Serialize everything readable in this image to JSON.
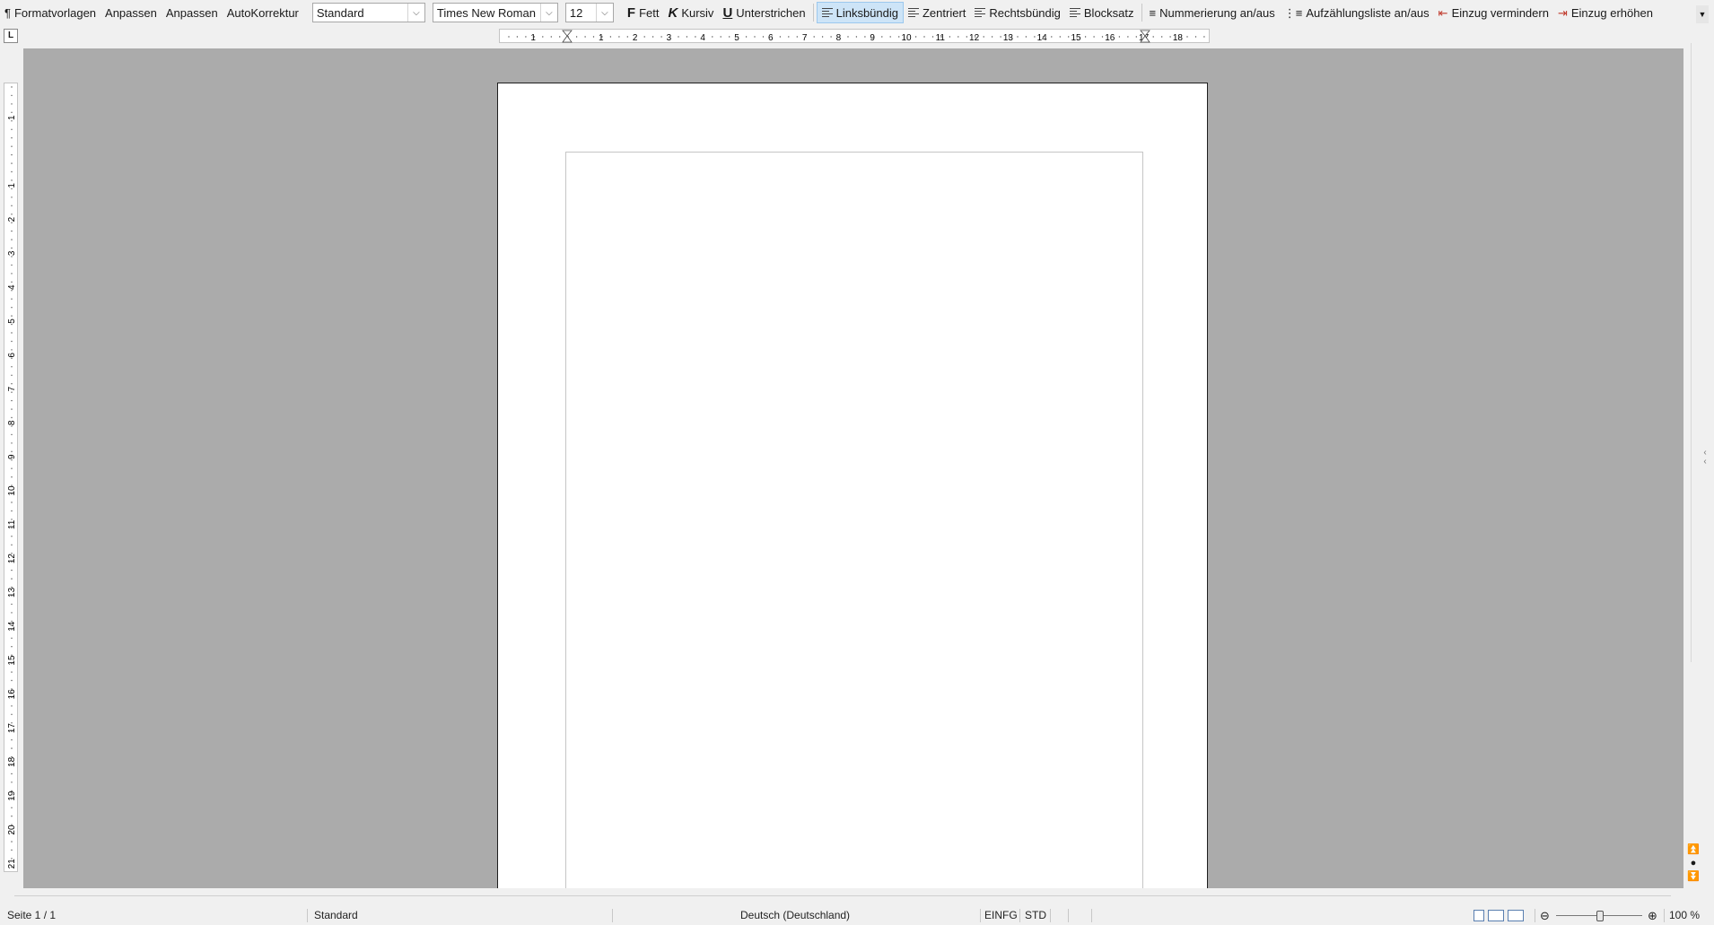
{
  "toolbar": {
    "format_templates": "Formatvorlagen",
    "customize1": "Anpassen",
    "customize2": "Anpassen",
    "autocorrect": "AutoKorrektur",
    "para_style": "Standard",
    "font_name": "Times New Roman",
    "font_size": "12",
    "bold": "Fett",
    "italic": "Kursiv",
    "underline": "Unterstrichen",
    "align_left": "Linksbündig",
    "align_center": "Zentriert",
    "align_right": "Rechtsbündig",
    "justify": "Blocksatz",
    "numbering": "Nummerierung an/aus",
    "bullets": "Aufzählungsliste an/aus",
    "indent_decrease": "Einzug vermindern",
    "indent_increase": "Einzug erhöhen",
    "bold_glyph": "F",
    "italic_glyph": "K",
    "underline_glyph": "U",
    "active_tool": "align_left"
  },
  "ruler": {
    "horizontal_labels": [
      "1",
      "1",
      "2",
      "3",
      "4",
      "5",
      "6",
      "7",
      "8",
      "9",
      "10",
      "11",
      "12",
      "13",
      "14",
      "15",
      "16",
      "17",
      "18"
    ],
    "vertical_labels": [
      "1",
      "1",
      "2",
      "3",
      "4",
      "5",
      "6",
      "7",
      "8",
      "9",
      "10",
      "11",
      "12",
      "13",
      "14",
      "15",
      "16",
      "17",
      "18",
      "19",
      "20",
      "21"
    ],
    "corner_glyph": "L"
  },
  "statusbar": {
    "page": "Seite 1 / 1",
    "style": "Standard",
    "language": "Deutsch (Deutschland)",
    "insert_mode": "EINFG",
    "selection_mode": "STD",
    "zoom": "100 %"
  },
  "colors": {
    "workspace": "#ababab",
    "active_button": "#cde4f7",
    "page": "#ffffff"
  }
}
